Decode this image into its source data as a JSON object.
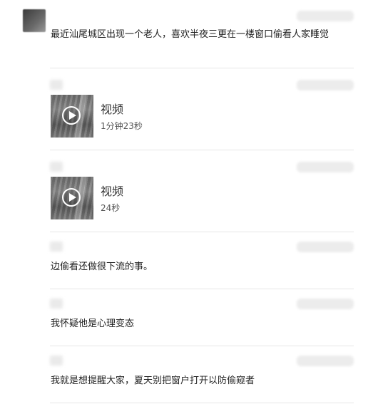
{
  "thread": {
    "messages": [
      {
        "type": "text",
        "text": "最近汕尾城区出现一个老人，喜欢半夜三更在一楼窗口偷看人家睡觉"
      },
      {
        "type": "video",
        "title": "视频",
        "duration": "1分钟23秒",
        "icon": "play-icon"
      },
      {
        "type": "video",
        "title": "视频",
        "duration": "24秒",
        "icon": "play-icon"
      },
      {
        "type": "text",
        "text": "边偷看还做很下流的事。"
      },
      {
        "type": "text",
        "text": "我怀疑他是心理变态"
      },
      {
        "type": "text",
        "text": "我就是想提醒大家，夏天别把窗户打开以防偷窥者"
      }
    ]
  }
}
